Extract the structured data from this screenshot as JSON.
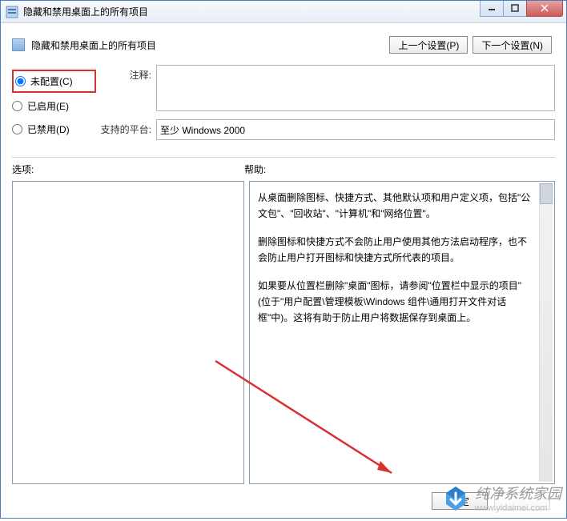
{
  "titlebar": {
    "title": "隐藏和禁用桌面上的所有项目"
  },
  "header": {
    "title": "隐藏和禁用桌面上的所有项目"
  },
  "nav": {
    "prev": "上一个设置(P)",
    "next": "下一个设置(N)"
  },
  "config": {
    "not_configured": "未配置(C)",
    "enabled": "已启用(E)",
    "disabled": "已禁用(D)"
  },
  "labels": {
    "comment": "注释:",
    "platform": "支持的平台:",
    "options": "选项:",
    "help": "帮助:"
  },
  "fields": {
    "comment": "",
    "platform": "至少 Windows 2000"
  },
  "options_panel": {
    "content": ""
  },
  "help_panel": {
    "p1": "从桌面删除图标、快捷方式、其他默认项和用户定义项，包括\"公文包\"、\"回收站\"、\"计算机\"和\"网络位置\"。",
    "p2": "删除图标和快捷方式不会防止用户使用其他方法启动程序，也不会防止用户打开图标和快捷方式所代表的项目。",
    "p3": "如果要从位置栏删除\"桌面\"图标，请参阅\"位置栏中显示的项目\"(位于\"用户配置\\管理模板\\Windows 组件\\通用打开文件对话框\"中)。这将有助于防止用户将数据保存到桌面上。"
  },
  "footer": {
    "ok": "确定"
  },
  "watermark": {
    "line1": "纯净系统家园",
    "line2": "www.yidaimei.com"
  }
}
